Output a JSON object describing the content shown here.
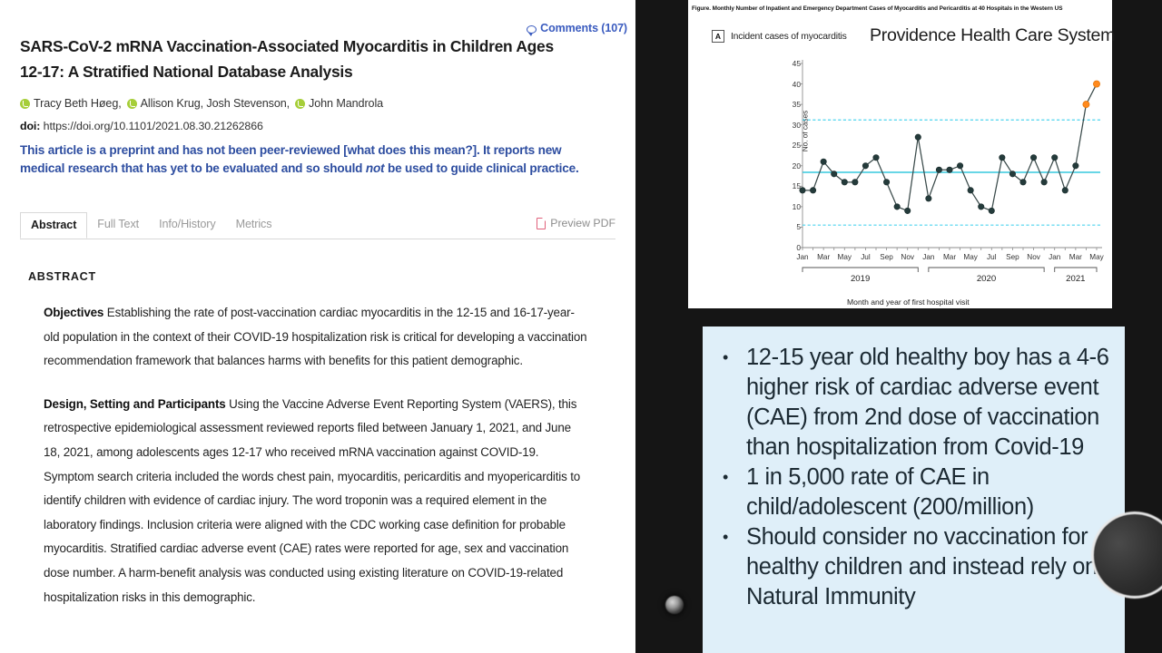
{
  "article": {
    "comments_label": "Comments (107)",
    "title": "SARS-CoV-2 mRNA Vaccination-Associated Myocarditis in Children Ages 12-17: A Stratified National Database Analysis",
    "authors": [
      {
        "name": "Tracy Beth Høeg,",
        "orcid": true
      },
      {
        "name": "Allison Krug, Josh Stevenson,",
        "orcid": true
      },
      {
        "name": "John Mandrola",
        "orcid": true
      }
    ],
    "doi_label": "doi:",
    "doi_value": "https://doi.org/10.1101/2021.08.30.21262866",
    "preprint_notice_part1": "This article is a preprint and has not been peer-reviewed [what does this mean?]. It reports new medical research that has yet to be evaluated and so should ",
    "preprint_notice_italic": "not",
    "preprint_notice_part2": " be used to guide clinical practice.",
    "tabs": [
      {
        "label": "Abstract",
        "active": true
      },
      {
        "label": "Full Text",
        "active": false
      },
      {
        "label": "Info/History",
        "active": false
      },
      {
        "label": "Metrics",
        "active": false
      }
    ],
    "preview_pdf_label": "Preview PDF",
    "abstract_heading": "ABSTRACT",
    "paragraphs": [
      {
        "heading": "Objectives",
        "text": " Establishing the rate of post-vaccination cardiac myocarditis in the 12-15 and 16-17-year-old population in the context of their COVID-19 hospitalization risk is critical for developing a vaccination recommendation framework that balances harms with benefits for this patient demographic."
      },
      {
        "heading": "Design, Setting and Participants",
        "text": " Using the Vaccine Adverse Event Reporting System (VAERS), this retrospective epidemiological assessment reviewed reports filed between January 1, 2021, and June 18, 2021, among adolescents ages 12-17 who received mRNA vaccination against COVID-19. Symptom search criteria included the words chest pain, myocarditis, pericarditis and myopericarditis to identify children with evidence of cardiac injury. The word troponin was a required element in the laboratory findings. Inclusion criteria were aligned with the CDC working case definition for probable myocarditis. Stratified cardiac adverse event (CAE) rates were reported for age, sex and vaccination dose number. A harm-benefit analysis was conducted using existing literature on COVID-19-related hospitalization risks in this demographic."
      }
    ]
  },
  "slide": {
    "figure_caption": "Figure.  Monthly Number of Inpatient and Emergency Department Cases of Myocarditis and Pericarditis at 40 Hospitals in the Western US",
    "panel_badge": "A",
    "panel_label": "Incident cases of myocarditis",
    "providence_title": "Providence Health Care System",
    "callout_bullets": [
      "12-15 year old healthy boy has a 4-6 higher risk of cardiac adverse event (CAE) from 2nd dose of vaccination than hospitalization from Covid-19",
      "1 in 5,000 rate of CAE in child/adolescent (200/million)",
      "Should consider no vaccination for healthy children and instead rely on Natural Immunity"
    ],
    "bullet_glyph": "•"
  },
  "colors": {
    "link_blue": "#3a5bbf",
    "notice_blue": "#2d4da0",
    "orcid_green": "#a6ce39",
    "pdf_red": "#e0607a",
    "callout_bg": "#dfeff9",
    "slide_bg": "#151515",
    "marker_dark": "#243b3b",
    "marker_orange": "#ff8a1e",
    "center_line": "#36c8dd",
    "limit_line": "#4fd4ee"
  },
  "chart_data": {
    "type": "line",
    "title": "Incident cases of myocarditis",
    "xlabel": "Month and year of first hospital visit",
    "ylabel": "No. of cases",
    "ylim": [
      0,
      45
    ],
    "yticks": [
      0,
      5,
      10,
      15,
      20,
      25,
      30,
      35,
      40,
      45
    ],
    "xtick_labels": [
      "Jan",
      "Mar",
      "May",
      "Jul",
      "Sep",
      "Nov",
      "Jan",
      "Mar",
      "May",
      "Jul",
      "Sep",
      "Nov",
      "Jan",
      "Mar",
      "May"
    ],
    "year_groups": [
      {
        "label": "2019",
        "start_index": 0,
        "end_index": 11
      },
      {
        "label": "2020",
        "start_index": 12,
        "end_index": 23
      },
      {
        "label": "2021",
        "start_index": 24,
        "end_index": 28
      }
    ],
    "x": [
      "2019-Jan",
      "2019-Feb",
      "2019-Mar",
      "2019-Apr",
      "2019-May",
      "2019-Jun",
      "2019-Jul",
      "2019-Aug",
      "2019-Sep",
      "2019-Oct",
      "2019-Nov",
      "2019-Dec",
      "2020-Jan",
      "2020-Feb",
      "2020-Mar",
      "2020-Apr",
      "2020-May",
      "2020-Jun",
      "2020-Jul",
      "2020-Aug",
      "2020-Sep",
      "2020-Oct",
      "2020-Nov",
      "2020-Dec",
      "2021-Jan",
      "2021-Feb",
      "2021-Mar",
      "2021-Apr",
      "2021-May"
    ],
    "values": [
      14,
      14,
      21,
      18,
      16,
      16,
      20,
      22,
      16,
      10,
      9,
      27,
      12,
      19,
      19,
      20,
      14,
      10,
      9,
      22,
      18,
      16,
      22,
      16,
      22,
      14,
      20,
      35,
      40
    ],
    "highlighted_indices": [
      27,
      28
    ],
    "center_line": 18.4,
    "upper_control_limit": 31.2,
    "lower_control_limit": 5.5,
    "grid": false,
    "legend": "none"
  }
}
